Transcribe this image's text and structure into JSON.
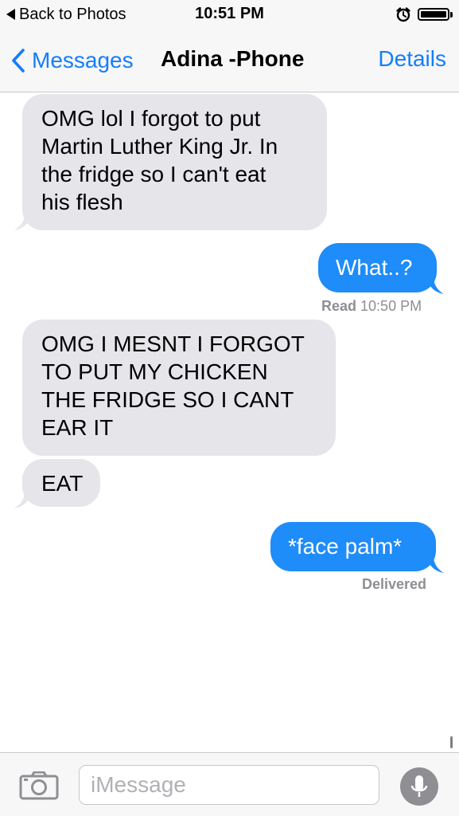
{
  "status_bar": {
    "back_label": "Back to Photos",
    "time": "10:51 PM"
  },
  "nav": {
    "back_label": "Messages",
    "title": "Adina -Phone",
    "details_label": "Details"
  },
  "messages": [
    {
      "direction": "incoming",
      "text": "OMG lol I forgot to put\nMartin Luther King Jr. In\nthe fridge so I can't eat\nhis flesh"
    },
    {
      "direction": "outgoing",
      "text": "What..?"
    },
    {
      "direction": "incoming",
      "text": "OMG I MESNT I FORGOT\nTO PUT MY CHICKEN\nTHE FRIDGE SO I CANT\nEAR IT"
    },
    {
      "direction": "incoming",
      "text": "EAT"
    },
    {
      "direction": "outgoing",
      "text": "*face palm*"
    }
  ],
  "receipts": {
    "read_label": "Read",
    "read_time": "10:50 PM",
    "delivered": "Delivered"
  },
  "input": {
    "placeholder": "iMessage"
  },
  "icons": {
    "back": "chevron-left-icon",
    "alarm": "alarm-clock-icon",
    "battery": "battery-icon",
    "camera": "camera-icon",
    "mic": "microphone-icon"
  },
  "colors": {
    "accent": "#147efb",
    "outgoing_bubble": "#1e8cf9",
    "incoming_bubble": "#e5e5ea",
    "receipt_text": "#8e8e93"
  }
}
